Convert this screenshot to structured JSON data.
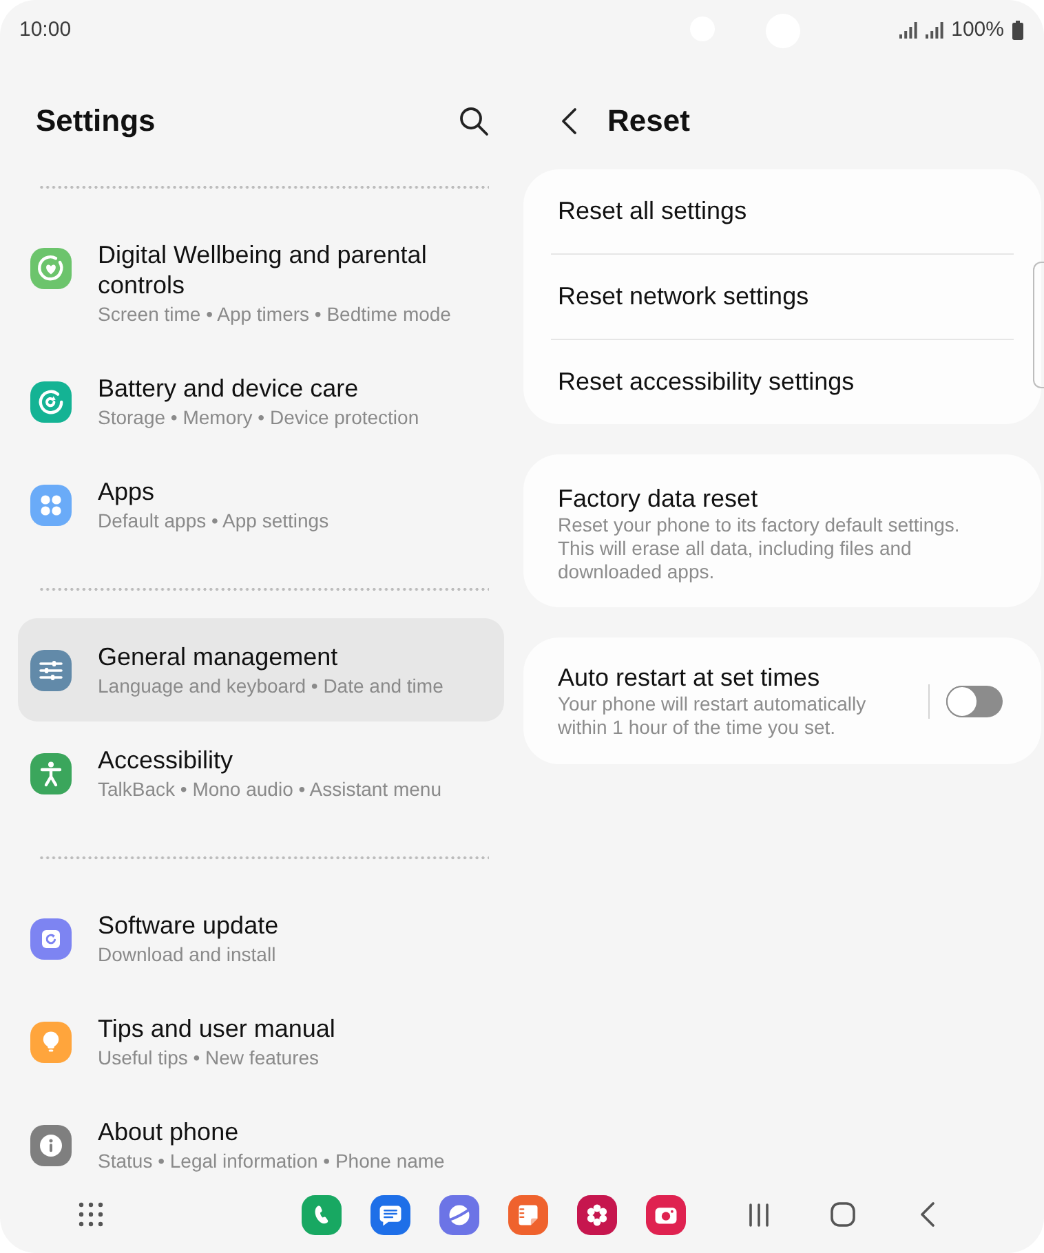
{
  "status_bar": {
    "time": "10:00",
    "battery": "100%"
  },
  "settings": {
    "title": "Settings",
    "groups": [
      {
        "items": [
          {
            "title": "Digital Wellbeing and parental controls",
            "subtitle": "Screen time • App timers • Bedtime mode",
            "color": "#6cc46c",
            "selected": false
          },
          {
            "title": "Battery and device care",
            "subtitle": "Storage • Memory • Device protection",
            "color": "#14b394",
            "selected": false
          },
          {
            "title": "Apps",
            "subtitle": "Default apps • App settings",
            "color": "#6aabf8",
            "selected": false
          }
        ]
      },
      {
        "items": [
          {
            "title": "General management",
            "subtitle": "Language and keyboard • Date and time",
            "color": "#628aa9",
            "selected": true
          },
          {
            "title": "Accessibility",
            "subtitle": "TalkBack • Mono audio • Assistant menu",
            "color": "#3ba65c",
            "selected": false
          }
        ]
      },
      {
        "items": [
          {
            "title": "Software update",
            "subtitle": "Download and install",
            "color": "#7d84f2",
            "selected": false
          },
          {
            "title": "Tips and user manual",
            "subtitle": "Useful tips • New features",
            "color": "#ffa53c",
            "selected": false
          },
          {
            "title": "About phone",
            "subtitle": "Status • Legal information • Phone name",
            "color": "#7f7f7f",
            "selected": false
          }
        ]
      }
    ]
  },
  "reset": {
    "title": "Reset",
    "cards": [
      {
        "rows": [
          {
            "kind": "plain",
            "title": "Reset all settings"
          },
          {
            "kind": "plain",
            "title": "Reset network settings"
          },
          {
            "kind": "plain",
            "title": "Reset accessibility settings"
          }
        ]
      },
      {
        "rows": [
          {
            "kind": "detail",
            "title": "Factory data reset",
            "description": "Reset your phone to its factory default settings. This will erase all data, including files and downloaded apps."
          }
        ]
      },
      {
        "rows": [
          {
            "kind": "switch",
            "title": "Auto restart at set times",
            "description": "Your phone will restart automatically within 1 hour of the time you set.",
            "on": false
          }
        ]
      }
    ]
  }
}
